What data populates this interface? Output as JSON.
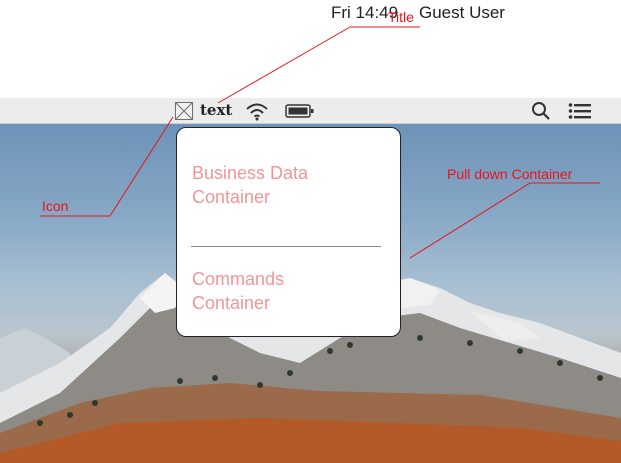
{
  "menubar": {
    "app_title": "text",
    "clock": "Fri 14:49",
    "user": "Guest User"
  },
  "pulldown": {
    "business_line1": "Business Data",
    "business_line2": "Container",
    "commands_line1": "Commands",
    "commands_line2": "Container"
  },
  "annotations": {
    "title": "Title",
    "icon": "Icon",
    "pulldown": "Pull down Container"
  },
  "colors": {
    "annotation": "#e8141a",
    "container_text": "#f19596",
    "menubar": "#ececec"
  },
  "icons": [
    "placeholder-icon",
    "wifi-icon",
    "battery-icon",
    "search-icon",
    "list-icon"
  ]
}
